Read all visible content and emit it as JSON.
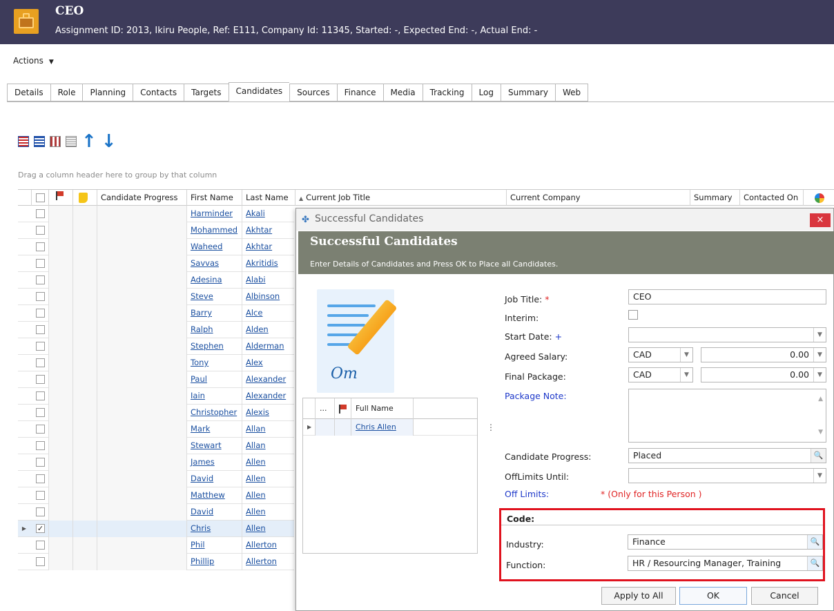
{
  "header": {
    "title": "CEO",
    "subtitle": "Assignment ID: 2013, Ikiru People, Ref: E111, Company Id: 11345, Started: -, Expected End: -, Actual End: -",
    "icon": "briefcase-icon"
  },
  "actions": {
    "label": "Actions"
  },
  "tabs": [
    {
      "label": "Details"
    },
    {
      "label": "Role"
    },
    {
      "label": "Planning"
    },
    {
      "label": "Contacts"
    },
    {
      "label": "Targets"
    },
    {
      "label": "Candidates",
      "active": true
    },
    {
      "label": "Sources"
    },
    {
      "label": "Finance"
    },
    {
      "label": "Media"
    },
    {
      "label": "Tracking"
    },
    {
      "label": "Log"
    },
    {
      "label": "Summary"
    },
    {
      "label": "Web"
    }
  ],
  "group_hint": "Drag a column header here to group by that column",
  "grid": {
    "columns": {
      "candidate_progress": "Candidate Progress",
      "first_name": "First Name",
      "last_name": "Last Name",
      "current_job_title": "Current Job Title",
      "current_company": "Current Company",
      "summary": "Summary",
      "contacted_on": "Contacted On"
    },
    "rows": [
      {
        "first": "Harminder",
        "last": "Akali",
        "checked": false
      },
      {
        "first": "Mohammed",
        "last": "Akhtar",
        "checked": false
      },
      {
        "first": "Waheed",
        "last": "Akhtar",
        "checked": false
      },
      {
        "first": "Savvas",
        "last": "Akritidis",
        "checked": false
      },
      {
        "first": "Adesina",
        "last": "Alabi",
        "checked": false
      },
      {
        "first": "Steve",
        "last": "Albinson",
        "checked": false
      },
      {
        "first": "Barry",
        "last": "Alce",
        "checked": false
      },
      {
        "first": "Ralph",
        "last": "Alden",
        "checked": false
      },
      {
        "first": "Stephen",
        "last": "Alderman",
        "checked": false
      },
      {
        "first": "Tony",
        "last": "Alex",
        "checked": false
      },
      {
        "first": "Paul",
        "last": "Alexander",
        "checked": false
      },
      {
        "first": "Iain",
        "last": "Alexander",
        "checked": false
      },
      {
        "first": "Christopher",
        "last": "Alexis",
        "checked": false
      },
      {
        "first": "Mark",
        "last": "Allan",
        "checked": false
      },
      {
        "first": "Stewart",
        "last": "Allan",
        "checked": false
      },
      {
        "first": "James",
        "last": "Allen",
        "checked": false
      },
      {
        "first": "David",
        "last": "Allen",
        "checked": false
      },
      {
        "first": "Matthew",
        "last": "Allen",
        "checked": false
      },
      {
        "first": "David",
        "last": "Allen",
        "checked": false
      },
      {
        "first": "Chris",
        "last": "Allen",
        "checked": true,
        "selected": true
      },
      {
        "first": "Phil",
        "last": "Allerton",
        "checked": false
      },
      {
        "first": "Phillip",
        "last": "Allerton",
        "checked": false
      }
    ]
  },
  "dialog": {
    "window_title": "Successful Candidates",
    "banner_title": "Successful Candidates",
    "banner_subtitle": "Enter Details of Candidates and Press OK to Place all Candidates.",
    "close_label": "×",
    "mini_grid": {
      "col_more": "...",
      "col_name": "Full Name",
      "row_name": "Chris Allen"
    },
    "splitter": "⋮",
    "fields": {
      "job_title_label": "Job Title:",
      "job_title_value": "CEO",
      "interim_label": "Interim:",
      "start_date_label": "Start Date:",
      "agreed_salary_label": "Agreed Salary:",
      "agreed_salary_currency": "CAD",
      "agreed_salary_amount": "0.00",
      "final_package_label": "Final Package:",
      "final_package_currency": "CAD",
      "final_package_amount": "0.00",
      "package_note_label": "Package Note:",
      "candidate_progress_label": "Candidate Progress:",
      "candidate_progress_value": "Placed",
      "offlimits_until_label": "OffLimits Until:",
      "off_limits_label": "Off Limits:",
      "off_limits_note": "* (Only for this Person )",
      "required_mark": "*",
      "plus_mark": "+"
    },
    "code": {
      "heading": "Code:",
      "industry_label": "Industry:",
      "industry_value": "Finance",
      "function_label": "Function:",
      "function_value": "HR / Resourcing Manager, Training"
    },
    "buttons": {
      "apply_all": "Apply to All",
      "ok": "OK",
      "cancel": "Cancel"
    }
  },
  "colors": {
    "header_bg": "#3d3b5a",
    "banner_bg": "#7b8072",
    "highlight_red": "#e0121e",
    "link_blue": "#1a4fa0"
  }
}
